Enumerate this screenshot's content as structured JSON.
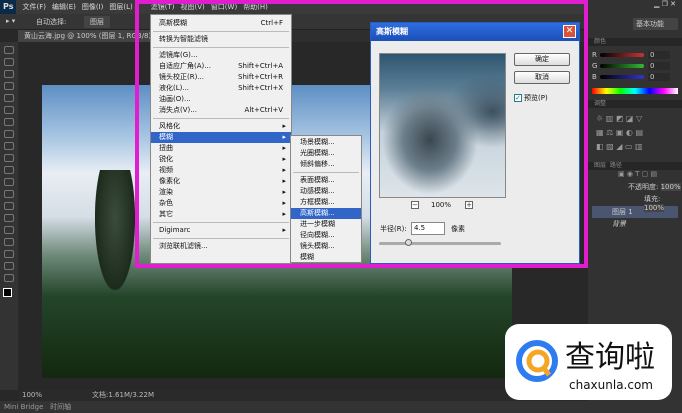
{
  "menubar": {
    "logo": "Ps",
    "items": [
      "文件(F)",
      "编辑(E)",
      "图像(I)",
      "图层(L)",
      "滤镜(T)",
      "视图(V)",
      "窗口(W)",
      "帮助(H)"
    ]
  },
  "options": {
    "auto_select": "自动选择:",
    "layer": "图层"
  },
  "document": {
    "tab": "黄山云海.jpg @ 100% (图层 1, RGB/8)"
  },
  "filter_menu": {
    "top": [
      {
        "label": "高斯模糊",
        "shortcut": "Ctrl+F"
      }
    ],
    "smart": "转换为智能滤镜",
    "items": [
      {
        "label": "滤镜库(G)...",
        "shortcut": ""
      },
      {
        "label": "自适应广角(A)...",
        "shortcut": "Shift+Ctrl+A"
      },
      {
        "label": "镜头校正(R)...",
        "shortcut": "Shift+Ctrl+R"
      },
      {
        "label": "液化(L)...",
        "shortcut": "Shift+Ctrl+X"
      },
      {
        "label": "油画(O)...",
        "shortcut": ""
      },
      {
        "label": "消失点(V)...",
        "shortcut": "Alt+Ctrl+V"
      }
    ],
    "groups": [
      "风格化",
      "模糊",
      "扭曲",
      "锐化",
      "视频",
      "像素化",
      "渲染",
      "杂色",
      "其它"
    ],
    "highlighted": "模糊",
    "digimarc": "Digimarc",
    "browse": "浏览联机滤镜..."
  },
  "blur_submenu": {
    "group1": [
      "场景模糊...",
      "光圈模糊...",
      "倾斜偏移..."
    ],
    "group2": [
      "表面模糊...",
      "动感模糊...",
      "方框模糊...",
      "高斯模糊...",
      "进一步模糊",
      "径向模糊...",
      "镜头模糊...",
      "模糊"
    ],
    "highlighted": "高斯模糊..."
  },
  "dialog": {
    "title": "高斯模糊",
    "ok": "确定",
    "cancel": "取消",
    "preview_label": "预览(P)",
    "preview_checked": true,
    "zoom": "100%",
    "zoom_out": "−",
    "zoom_in": "+",
    "radius_label": "半径(R):",
    "radius_value": "4.5",
    "unit": "像素",
    "close": "✕"
  },
  "right_panel": {
    "workspace": "基本功能",
    "color_tab": "颜色",
    "rgb": [
      "R",
      "G",
      "B"
    ],
    "rgb_values": [
      "0",
      "0",
      "0"
    ],
    "adjust_tab": "调整",
    "layers_tab": "图层",
    "paths_tab": "路径",
    "opacity_label": "不透明度:",
    "opacity": "100%",
    "fill_label": "填充:",
    "fill": "100%",
    "layers": [
      "图层 1",
      "背景"
    ]
  },
  "status": {
    "zoom": "100%",
    "doc": "文档:1.61M/3.22M"
  },
  "bottom": {
    "tabs": [
      "Mini Bridge",
      "时间轴"
    ]
  },
  "watermark": {
    "name": "查询啦",
    "url": "chaxunla.com"
  },
  "colors": {
    "highlight": "#3165c8",
    "frame": "#e21ccf",
    "dialog_title": "#2e6ee0"
  }
}
